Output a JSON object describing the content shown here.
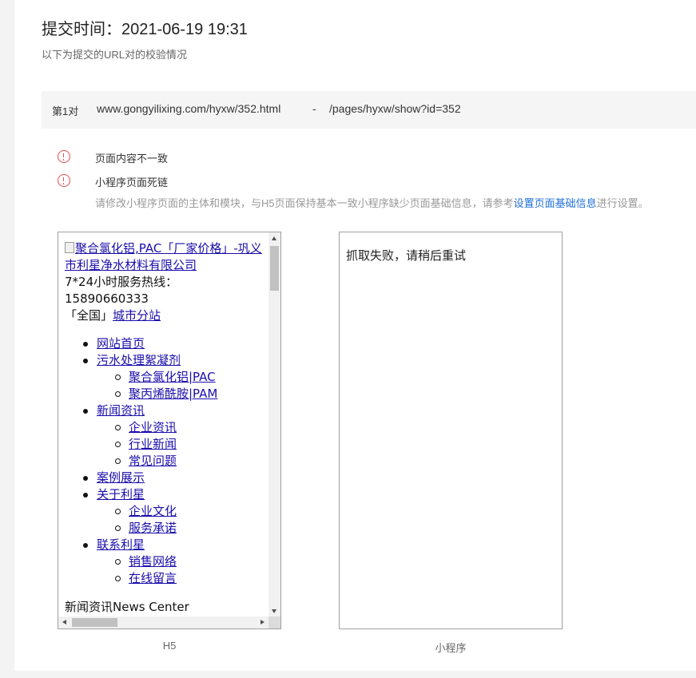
{
  "header": {
    "title": "提交时间：2021-06-19 19:31",
    "subtitle": "以下为提交的URL对的校验情况"
  },
  "pair": {
    "index": "第1对",
    "h5_url": "www.gongyilixing.com/hyxw/352.html",
    "separator": "-",
    "mp_path": "/pages/hyxw/show?id=352"
  },
  "issues": [
    {
      "icon": "warning-circle-icon",
      "label": "页面内容不一致"
    },
    {
      "icon": "warning-circle-icon",
      "label": "小程序页面死链",
      "desc_before": "请修改小程序页面的主体和模块，与H5页面保持基本一致小程序缺少页面基础信息，请参考",
      "desc_link": "设置页面基础信息",
      "desc_after": "进行设置。"
    }
  ],
  "h5_preview": {
    "logo_alt": "聚合氯化铝,PAC「厂家价格」-巩义市利星净水材料有限公司",
    "hotline_label": "7*24小时服务热线：",
    "hotline_number": "15890660333",
    "region_prefix": "「全国」",
    "region_link": "城市分站",
    "nav": {
      "home": "网站首页",
      "wastewater": "污水处理絮凝剂",
      "pac": "聚合氯化铝|PAC",
      "pam": "聚丙烯酰胺|PAM",
      "news": "新闻资讯",
      "company_news": "企业资讯",
      "industry_news": "行业新闻",
      "faq": "常见问题",
      "cases": "案例展示",
      "about": "关于利星",
      "culture": "企业文化",
      "promise": "服务承诺",
      "contact": "联系利星",
      "sales_network": "销售网络",
      "online_message": "在线留言"
    },
    "news_heading": "新闻资讯News Center"
  },
  "mp_preview": {
    "message": "抓取失败，请稍后重试"
  },
  "captions": {
    "h5": "H5",
    "mp": "小程序"
  },
  "colors": {
    "warning": "#e34d4d",
    "link": "#1e6fd9",
    "h5_link": "#1a0dab"
  }
}
